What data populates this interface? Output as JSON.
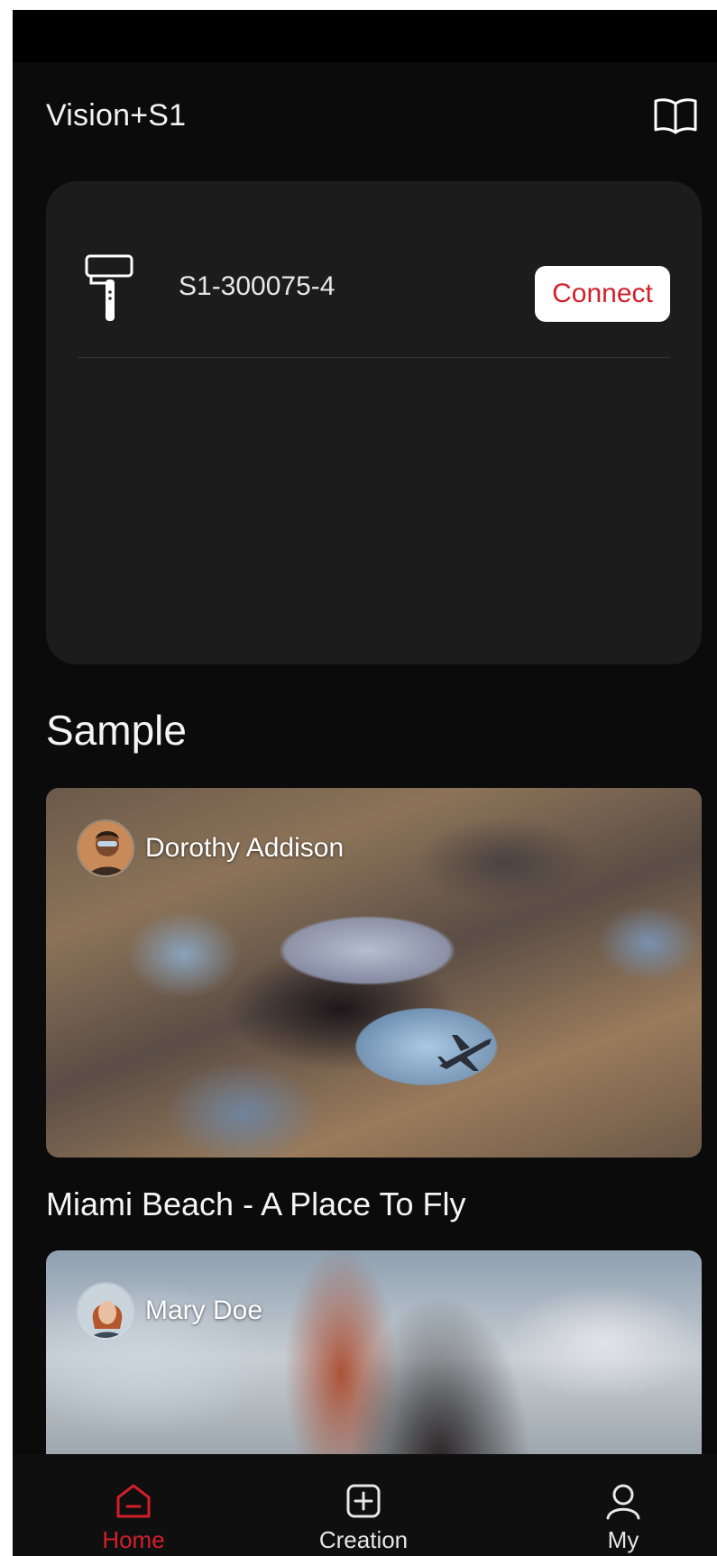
{
  "header": {
    "title": "Vision+S1",
    "guide_icon": "open-book-icon"
  },
  "device": {
    "icon": "selfie-stick-gimbal-icon",
    "name": "S1-300075-4",
    "connect_label": "Connect"
  },
  "sample": {
    "title": "Sample",
    "cards": [
      {
        "author": "Dorothy Addison",
        "title": "Miami Beach - A Place To Fly"
      },
      {
        "author": "Mary Doe"
      }
    ]
  },
  "bottom_nav": {
    "items": [
      {
        "label": "Home",
        "icon": "home-icon",
        "active": true
      },
      {
        "label": "Creation",
        "icon": "plus-square-icon",
        "active": false
      },
      {
        "label": "My",
        "icon": "person-icon",
        "active": false
      }
    ]
  },
  "colors": {
    "accent": "#d21f2a",
    "background": "#0b0b0b",
    "card": "#1c1c1c"
  }
}
